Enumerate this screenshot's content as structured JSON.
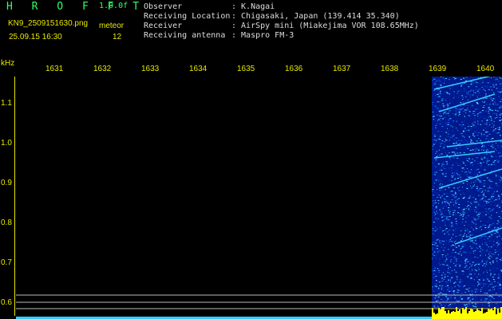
{
  "header": {
    "title": "H R O F F T",
    "version": "1.0.0f",
    "filename": "KN9_2509151630.png",
    "mode": "meteor",
    "datetime": "25.09.15 16:30",
    "count": "12"
  },
  "info": [
    {
      "key": "Observer",
      "value": ": K.Nagai"
    },
    {
      "key": "Receiving Location",
      "value": ": Chigasaki, Japan (139.414 35.340)"
    },
    {
      "key": "Receiver",
      "value": ": AirSpy mini (Miakejima VOR 108.65MHz)"
    },
    {
      "key": "Receiving antenna",
      "value": ": Maspro FM-3"
    }
  ],
  "axes": {
    "y_unit": "kHz",
    "x_ticks": [
      "1631",
      "1632",
      "1633",
      "1634",
      "1635",
      "1636",
      "1637",
      "1638",
      "1639",
      "1640"
    ],
    "y_ticks": [
      "1.1",
      "1.0",
      "0.9",
      "0.8",
      "0.7",
      "0.6"
    ]
  },
  "colors": {
    "header_yellow": "#e8e800",
    "header_green": "#33ff66",
    "info_white": "#dddddd",
    "spectrum_dark": "#001a8c",
    "spectrum_bright": "#33ccff",
    "baseline_yellow": "#ffff00"
  }
}
